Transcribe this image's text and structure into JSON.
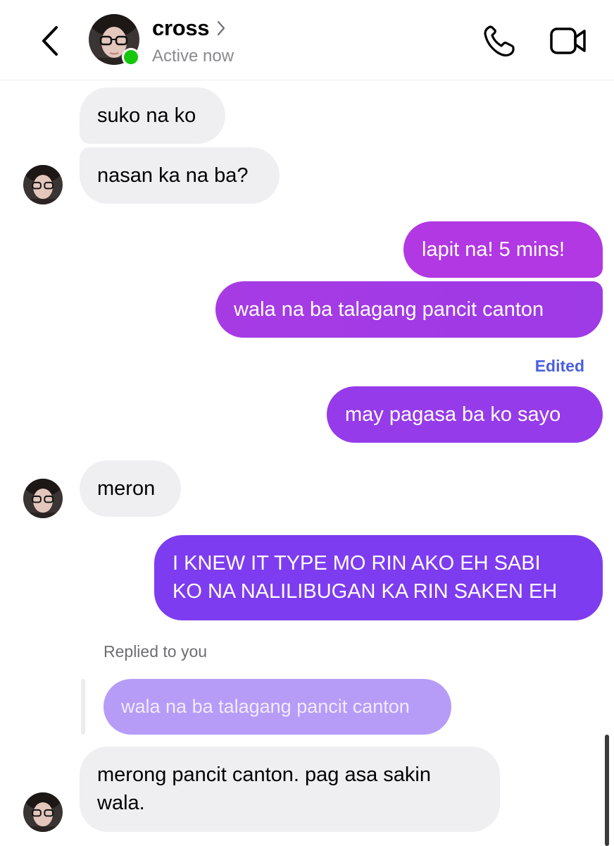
{
  "header": {
    "contact_name": "cross",
    "status": "Active now"
  },
  "messages": [
    {
      "from": "them",
      "text": "suko na ko"
    },
    {
      "from": "them",
      "text": "nasan ka na ba?"
    },
    {
      "from": "me",
      "text": "lapit na! 5 mins!"
    },
    {
      "from": "me",
      "text": "wala na ba talagang pancit canton"
    },
    {
      "from": "me",
      "text": "may pagasa ba ko sayo",
      "edited_label": "Edited"
    },
    {
      "from": "them",
      "text": "meron"
    },
    {
      "from": "me",
      "lines": [
        "I KNEW IT TYPE MO RIN AKO EH SABI",
        "KO NA NALILIBUGAN KA RIN SAKEN EH"
      ]
    },
    {
      "from": "them",
      "reply_label": "Replied to you",
      "quoted": "wala na ba talagang pancit canton",
      "lines": [
        "merong pancit canton. pag asa sakin",
        "wala."
      ]
    }
  ],
  "colors": {
    "incoming_bubble": "#efeff2",
    "outgoing_gradient": [
      "#b235e3",
      "#7a3cf0"
    ],
    "quoted_bubble": "#b69cf7",
    "edited_label": "#4a5fe0",
    "active_dot": "#16c60c"
  },
  "icons": [
    "back-chevron-icon",
    "chevron-right-icon",
    "phone-icon",
    "video-camera-icon"
  ]
}
